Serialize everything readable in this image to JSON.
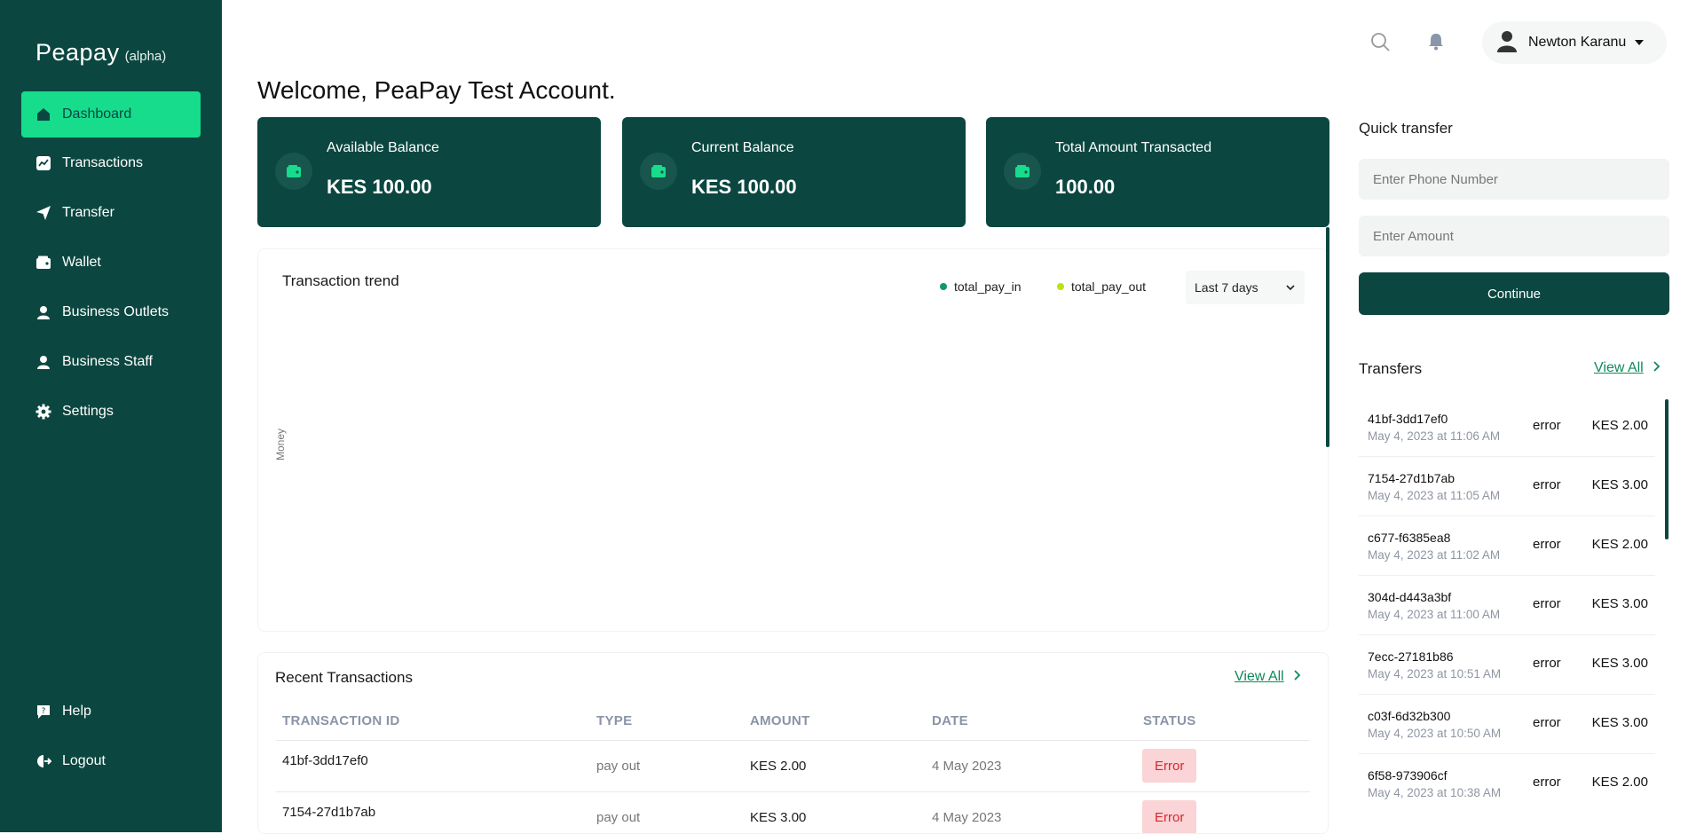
{
  "brand": {
    "name": "Peapay",
    "tag": "(alpha)"
  },
  "sidebar": {
    "items": [
      {
        "label": "Dashboard",
        "icon": "home-icon",
        "active": true
      },
      {
        "label": "Transactions",
        "icon": "chart-icon"
      },
      {
        "label": "Transfer",
        "icon": "send-icon"
      },
      {
        "label": "Wallet",
        "icon": "wallet-icon"
      },
      {
        "label": "Business Outlets",
        "icon": "user-icon"
      },
      {
        "label": "Business Staff",
        "icon": "user-icon"
      },
      {
        "label": "Settings",
        "icon": "gear-icon"
      }
    ],
    "bottom": [
      {
        "label": "Help",
        "icon": "help-icon"
      },
      {
        "label": "Logout",
        "icon": "logout-icon"
      }
    ]
  },
  "topbar": {
    "user_name": "Newton Karanu"
  },
  "welcome": "Welcome, PeaPay Test Account.",
  "cards": [
    {
      "label": "Available Balance",
      "value": "KES 100.00"
    },
    {
      "label": "Current Balance",
      "value": "KES 100.00"
    },
    {
      "label": "Total Amount Transacted",
      "value": "100.00"
    }
  ],
  "chart": {
    "title": "Transaction trend",
    "legend": [
      {
        "name": "total_pay_in",
        "color": "#0e9a63"
      },
      {
        "name": "total_pay_out",
        "color": "#b8e31a"
      }
    ],
    "range": "Last 7 days",
    "ylabel": "Money"
  },
  "chart_data": {
    "type": "line",
    "title": "Transaction trend",
    "ylabel": "Money",
    "series": [
      {
        "name": "total_pay_in",
        "values": []
      },
      {
        "name": "total_pay_out",
        "values": []
      }
    ]
  },
  "recent": {
    "title": "Recent Transactions",
    "view_all": "View All",
    "columns": [
      "TRANSACTION ID",
      "TYPE",
      "AMOUNT",
      "DATE",
      "STATUS"
    ],
    "rows": [
      {
        "id": "41bf-3dd17ef0",
        "type": "pay out",
        "amount": "KES 2.00",
        "date": "4 May 2023",
        "status": "Error"
      },
      {
        "id": "7154-27d1b7ab",
        "type": "pay out",
        "amount": "KES 3.00",
        "date": "4 May 2023",
        "status": "Error"
      }
    ]
  },
  "quick_transfer": {
    "title": "Quick transfer",
    "phone_placeholder": "Enter Phone Number",
    "amount_placeholder": "Enter Amount",
    "continue": "Continue"
  },
  "transfers": {
    "title": "Transfers",
    "view_all": "View All",
    "items": [
      {
        "id": "41bf-3dd17ef0",
        "date": "May 4, 2023 at 11:06 AM",
        "status": "error",
        "amount": "KES 2.00"
      },
      {
        "id": "7154-27d1b7ab",
        "date": "May 4, 2023 at 11:05 AM",
        "status": "error",
        "amount": "KES 3.00"
      },
      {
        "id": "c677-f6385ea8",
        "date": "May 4, 2023 at 11:02 AM",
        "status": "error",
        "amount": "KES 2.00"
      },
      {
        "id": "304d-d443a3bf",
        "date": "May 4, 2023 at 11:00 AM",
        "status": "error",
        "amount": "KES 3.00"
      },
      {
        "id": "7ecc-27181b86",
        "date": "May 4, 2023 at 10:51 AM",
        "status": "error",
        "amount": "KES 3.00"
      },
      {
        "id": "c03f-6d32b300",
        "date": "May 4, 2023 at 10:50 AM",
        "status": "error",
        "amount": "KES 3.00"
      },
      {
        "id": "6f58-973906cf",
        "date": "May 4, 2023 at 10:38 AM",
        "status": "error",
        "amount": "KES 2.00"
      }
    ]
  }
}
